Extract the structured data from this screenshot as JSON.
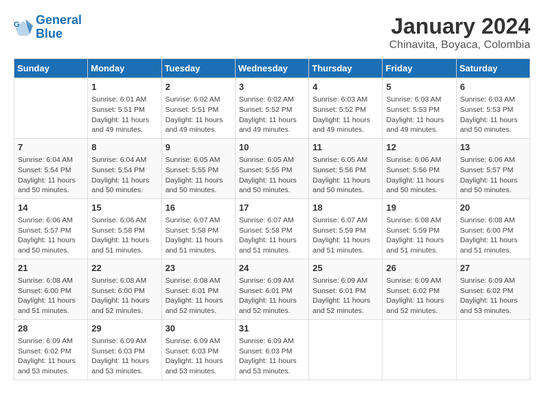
{
  "logo": {
    "general": "General",
    "blue": "Blue"
  },
  "title": "January 2024",
  "subtitle": "Chinavita, Boyaca, Colombia",
  "days_of_week": [
    "Sunday",
    "Monday",
    "Tuesday",
    "Wednesday",
    "Thursday",
    "Friday",
    "Saturday"
  ],
  "weeks": [
    [
      {
        "day": "",
        "content": ""
      },
      {
        "day": "1",
        "content": "Sunrise: 6:01 AM\nSunset: 5:51 PM\nDaylight: 11 hours\nand 49 minutes."
      },
      {
        "day": "2",
        "content": "Sunrise: 6:02 AM\nSunset: 5:51 PM\nDaylight: 11 hours\nand 49 minutes."
      },
      {
        "day": "3",
        "content": "Sunrise: 6:02 AM\nSunset: 5:52 PM\nDaylight: 11 hours\nand 49 minutes."
      },
      {
        "day": "4",
        "content": "Sunrise: 6:03 AM\nSunset: 5:52 PM\nDaylight: 11 hours\nand 49 minutes."
      },
      {
        "day": "5",
        "content": "Sunrise: 6:03 AM\nSunset: 5:53 PM\nDaylight: 11 hours\nand 49 minutes."
      },
      {
        "day": "6",
        "content": "Sunrise: 6:03 AM\nSunset: 5:53 PM\nDaylight: 11 hours\nand 50 minutes."
      }
    ],
    [
      {
        "day": "7",
        "content": "Sunrise: 6:04 AM\nSunset: 5:54 PM\nDaylight: 11 hours\nand 50 minutes."
      },
      {
        "day": "8",
        "content": "Sunrise: 6:04 AM\nSunset: 5:54 PM\nDaylight: 11 hours\nand 50 minutes."
      },
      {
        "day": "9",
        "content": "Sunrise: 6:05 AM\nSunset: 5:55 PM\nDaylight: 11 hours\nand 50 minutes."
      },
      {
        "day": "10",
        "content": "Sunrise: 6:05 AM\nSunset: 5:55 PM\nDaylight: 11 hours\nand 50 minutes."
      },
      {
        "day": "11",
        "content": "Sunrise: 6:05 AM\nSunset: 5:56 PM\nDaylight: 11 hours\nand 50 minutes."
      },
      {
        "day": "12",
        "content": "Sunrise: 6:06 AM\nSunset: 5:56 PM\nDaylight: 11 hours\nand 50 minutes."
      },
      {
        "day": "13",
        "content": "Sunrise: 6:06 AM\nSunset: 5:57 PM\nDaylight: 11 hours\nand 50 minutes."
      }
    ],
    [
      {
        "day": "14",
        "content": "Sunrise: 6:06 AM\nSunset: 5:57 PM\nDaylight: 11 hours\nand 50 minutes."
      },
      {
        "day": "15",
        "content": "Sunrise: 6:06 AM\nSunset: 5:58 PM\nDaylight: 11 hours\nand 51 minutes."
      },
      {
        "day": "16",
        "content": "Sunrise: 6:07 AM\nSunset: 5:58 PM\nDaylight: 11 hours\nand 51 minutes."
      },
      {
        "day": "17",
        "content": "Sunrise: 6:07 AM\nSunset: 5:58 PM\nDaylight: 11 hours\nand 51 minutes."
      },
      {
        "day": "18",
        "content": "Sunrise: 6:07 AM\nSunset: 5:59 PM\nDaylight: 11 hours\nand 51 minutes."
      },
      {
        "day": "19",
        "content": "Sunrise: 6:08 AM\nSunset: 5:59 PM\nDaylight: 11 hours\nand 51 minutes."
      },
      {
        "day": "20",
        "content": "Sunrise: 6:08 AM\nSunset: 6:00 PM\nDaylight: 11 hours\nand 51 minutes."
      }
    ],
    [
      {
        "day": "21",
        "content": "Sunrise: 6:08 AM\nSunset: 6:00 PM\nDaylight: 11 hours\nand 51 minutes."
      },
      {
        "day": "22",
        "content": "Sunrise: 6:08 AM\nSunset: 6:00 PM\nDaylight: 11 hours\nand 52 minutes."
      },
      {
        "day": "23",
        "content": "Sunrise: 6:08 AM\nSunset: 6:01 PM\nDaylight: 11 hours\nand 52 minutes."
      },
      {
        "day": "24",
        "content": "Sunrise: 6:09 AM\nSunset: 6:01 PM\nDaylight: 11 hours\nand 52 minutes."
      },
      {
        "day": "25",
        "content": "Sunrise: 6:09 AM\nSunset: 6:01 PM\nDaylight: 11 hours\nand 52 minutes."
      },
      {
        "day": "26",
        "content": "Sunrise: 6:09 AM\nSunset: 6:02 PM\nDaylight: 11 hours\nand 52 minutes."
      },
      {
        "day": "27",
        "content": "Sunrise: 6:09 AM\nSunset: 6:02 PM\nDaylight: 11 hours\nand 53 minutes."
      }
    ],
    [
      {
        "day": "28",
        "content": "Sunrise: 6:09 AM\nSunset: 6:02 PM\nDaylight: 11 hours\nand 53 minutes."
      },
      {
        "day": "29",
        "content": "Sunrise: 6:09 AM\nSunset: 6:03 PM\nDaylight: 11 hours\nand 53 minutes."
      },
      {
        "day": "30",
        "content": "Sunrise: 6:09 AM\nSunset: 6:03 PM\nDaylight: 11 hours\nand 53 minutes."
      },
      {
        "day": "31",
        "content": "Sunrise: 6:09 AM\nSunset: 6:03 PM\nDaylight: 11 hours\nand 53 minutes."
      },
      {
        "day": "",
        "content": ""
      },
      {
        "day": "",
        "content": ""
      },
      {
        "day": "",
        "content": ""
      }
    ]
  ]
}
